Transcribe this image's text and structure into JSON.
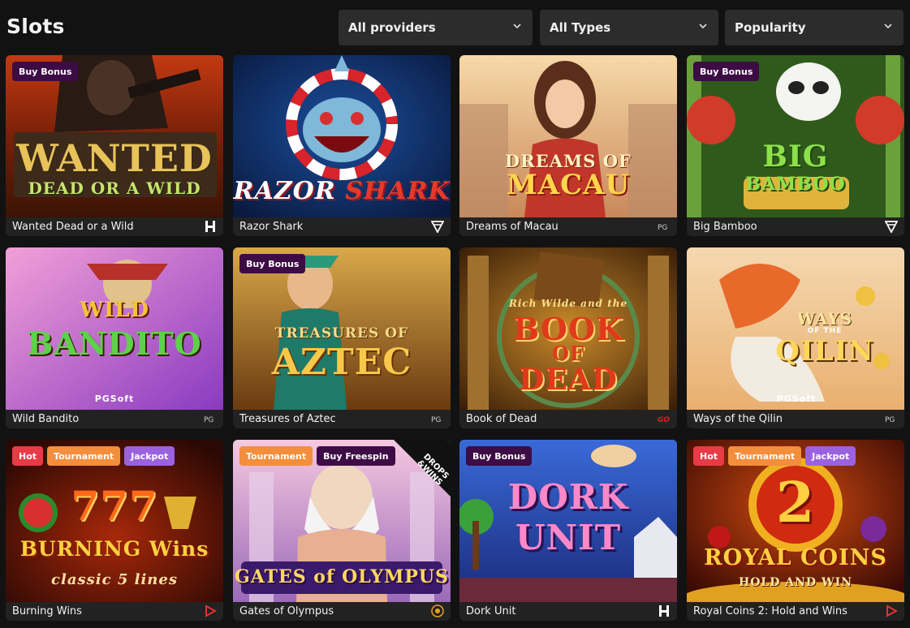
{
  "page": {
    "title": "Slots"
  },
  "filters": [
    {
      "label": "All providers"
    },
    {
      "label": "All Types"
    },
    {
      "label": "Popularity"
    }
  ],
  "colors": {
    "background": "#121212",
    "filter_bg": "#2c2c2c",
    "caption_bg": "#222222",
    "badge_buy": "#3d0c45",
    "badge_hot": "#e83b46",
    "badge_tournament": "#f28e3c",
    "badge_jackpot": "#9b62e0"
  },
  "games": [
    {
      "title": "Wanted Dead or a Wild",
      "badges": [
        "Buy Bonus"
      ],
      "provider_icon": "hacksaw-icon",
      "art_lines": [
        "WANTED",
        "DEAD OR A WILD"
      ]
    },
    {
      "title": "Razor Shark",
      "badges": [],
      "provider_icon": "push-gaming-icon",
      "art_lines": [
        "RAZOR",
        "SHARK"
      ]
    },
    {
      "title": "Dreams of Macau",
      "badges": [],
      "provider_icon": "pg-soft-icon",
      "art_lines": [
        "DREAMS OF",
        "MACAU"
      ]
    },
    {
      "title": "Big Bamboo",
      "badges": [
        "Buy Bonus"
      ],
      "provider_icon": "push-gaming-icon",
      "art_lines": [
        "BIG",
        "BAMBOO"
      ]
    },
    {
      "title": "Wild Bandito",
      "badges": [],
      "provider_icon": "pg-soft-icon",
      "art_lines": [
        "WILD",
        "BANDITO",
        "PGSoft"
      ]
    },
    {
      "title": "Treasures of Aztec",
      "badges": [
        "Buy Bonus"
      ],
      "provider_icon": "pg-soft-icon",
      "art_lines": [
        "TREASURES OF",
        "AZTEC"
      ]
    },
    {
      "title": "Book of Dead",
      "badges": [],
      "provider_icon": "play-n-go-icon",
      "art_lines": [
        "Rich Wilde and the",
        "BOOK",
        "OF",
        "DEAD"
      ]
    },
    {
      "title": "Ways of the Qilin",
      "badges": [],
      "provider_icon": "pg-soft-icon",
      "art_lines": [
        "WAYS",
        "OF THE",
        "QILIN",
        "PGSoft"
      ]
    },
    {
      "title": "Burning Wins",
      "badges": [
        "Hot",
        "Tournament",
        "Jackpot"
      ],
      "provider_icon": "playson-icon",
      "art_lines": [
        "777",
        "BURNING Wins",
        "classic 5 lines"
      ]
    },
    {
      "title": "Gates of Olympus",
      "badges": [
        "Tournament",
        "Buy Freespin"
      ],
      "provider_icon": "pragmatic-play-icon",
      "art_lines": [
        "GATES of OLYMPUS",
        "DROPS",
        "&WINS"
      ]
    },
    {
      "title": "Dork Unit",
      "badges": [
        "Buy Bonus"
      ],
      "provider_icon": "hacksaw-icon",
      "art_lines": [
        "DORK",
        "UNIT"
      ]
    },
    {
      "title": "Royal Coins 2: Hold and Wins",
      "badges": [
        "Hot",
        "Tournament",
        "Jackpot"
      ],
      "provider_icon": "playson-icon",
      "art_lines": [
        "2",
        "ROYAL COINS",
        "HOLD AND WIN"
      ]
    }
  ]
}
